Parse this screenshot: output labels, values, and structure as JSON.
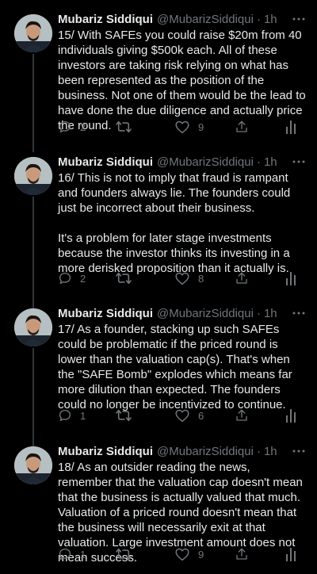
{
  "theme": {
    "background": "#000000",
    "text": "#e7e9ea",
    "muted": "#71767b",
    "thread_line": "#333639"
  },
  "tweets": [
    {
      "name": "Mubariz Siddiqui",
      "handle": "@MubarizSiddiqui",
      "separator": "·",
      "time": "1h",
      "text": "15/ With SAFEs you could raise $20m from 40 individuals giving $500k each. All of these investors are taking risk relying on what has been represented as the position of the business. Not one of them would be the lead to have done the due diligence and actually price the round.",
      "replies": "2",
      "retweets": "",
      "likes": "9"
    },
    {
      "name": "Mubariz Siddiqui",
      "handle": "@MubarizSiddiqui",
      "separator": "·",
      "time": "1h",
      "text": "16/ This is not to imply that fraud is rampant and founders always lie. The founders could just be incorrect about their business.\n\nIt's a problem for later stage investments because the investor thinks its investing in a more derisked proposition than it actually is.",
      "replies": "2",
      "retweets": "",
      "likes": "8"
    },
    {
      "name": "Mubariz Siddiqui",
      "handle": "@MubarizSiddiqui",
      "separator": "·",
      "time": "1h",
      "text": "17/ As a founder, stacking up such SAFEs could be problematic if the priced round is lower than the valuation cap(s). That's when the \"SAFE Bomb\" explodes which means far more dilution than expected. The founders could no longer be incentivized to continue.",
      "replies": "1",
      "retweets": "",
      "likes": "6"
    },
    {
      "name": "Mubariz Siddiqui",
      "handle": "@MubarizSiddiqui",
      "separator": "·",
      "time": "1h",
      "text": "18/ As an outsider reading the news, remember that the valuation cap doesn't mean that the business is actually valued that much. Valuation of a priced round doesn't mean that the business will necessarily exit at that valuation. Large investment amount does not mean success.",
      "replies": "1",
      "retweets": "",
      "likes": "9"
    }
  ]
}
